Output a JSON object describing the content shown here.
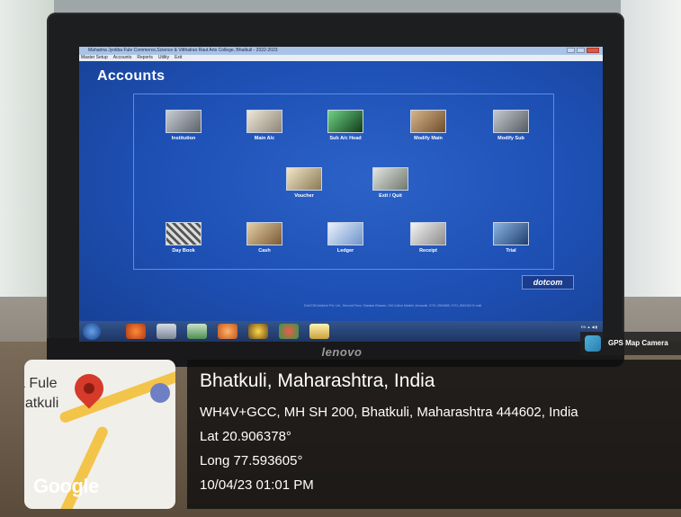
{
  "app": {
    "title": "Mahatma Jyotiba Fule Commerce,Science & Vitthalrao Raut Arts College, Bhatkuli - 2022-2023",
    "menu": [
      "Master Setup",
      "Accounts",
      "Reports",
      "Utility",
      "Exit"
    ],
    "heading": "Accounts",
    "tiles": [
      {
        "label": "Institution",
        "icon": "building-icon",
        "color": "#8f9aa6"
      },
      {
        "label": "Main A/c",
        "icon": "pen-icon",
        "color": "#c8c1b0"
      },
      {
        "label": "Sub A/c Head",
        "icon": "green-screen-icon",
        "color": "#2e7a3c"
      },
      {
        "label": "Modify Main",
        "icon": "papers-icon",
        "color": "#a98560"
      },
      {
        "label": "Modify Sub",
        "icon": "calculator-icon",
        "color": "#8a8f96"
      },
      {
        "label": "Voucher",
        "icon": "pens-icon",
        "color": "#d8c7a0"
      },
      {
        "label": "Exit / Quit",
        "icon": "exit-icon",
        "color": "#9aa49a"
      },
      {
        "label": "Day Book",
        "icon": "keyboard-icon",
        "color": "#6d6d6d"
      },
      {
        "label": "Cash",
        "icon": "cash-icon",
        "color": "#b89a6e"
      },
      {
        "label": "Ledger",
        "icon": "graph-icon",
        "color": "#7ea0d6"
      },
      {
        "label": "Receipt",
        "icon": "scale-icon",
        "color": "#bfbfbf"
      },
      {
        "label": "Trial",
        "icon": "trial-icon",
        "color": "#3a6ea8"
      }
    ],
    "logo": "dotcom",
    "footer": "DotCOM Infotech Pvt. Ltd., Second Floor, Shankar Bhavan, Old Cotton Market, Amravati. 0721-2594685, 0721-2540163 E-mail"
  },
  "monitor": {
    "brand": "lenovo"
  },
  "gps": {
    "badge_label": "GPS Map Camera",
    "map": {
      "text_line1": "a Fule",
      "text_line2": "hatkuli",
      "google": "Google"
    },
    "place": "Bhatkuli, Maharashtra, India",
    "address": "WH4V+GCC, MH SH 200, Bhatkuli, Maharashtra 444602, India",
    "lat": "Lat 20.906378°",
    "long": "Long 77.593605°",
    "datetime": "10/04/23 01:01 PM"
  }
}
